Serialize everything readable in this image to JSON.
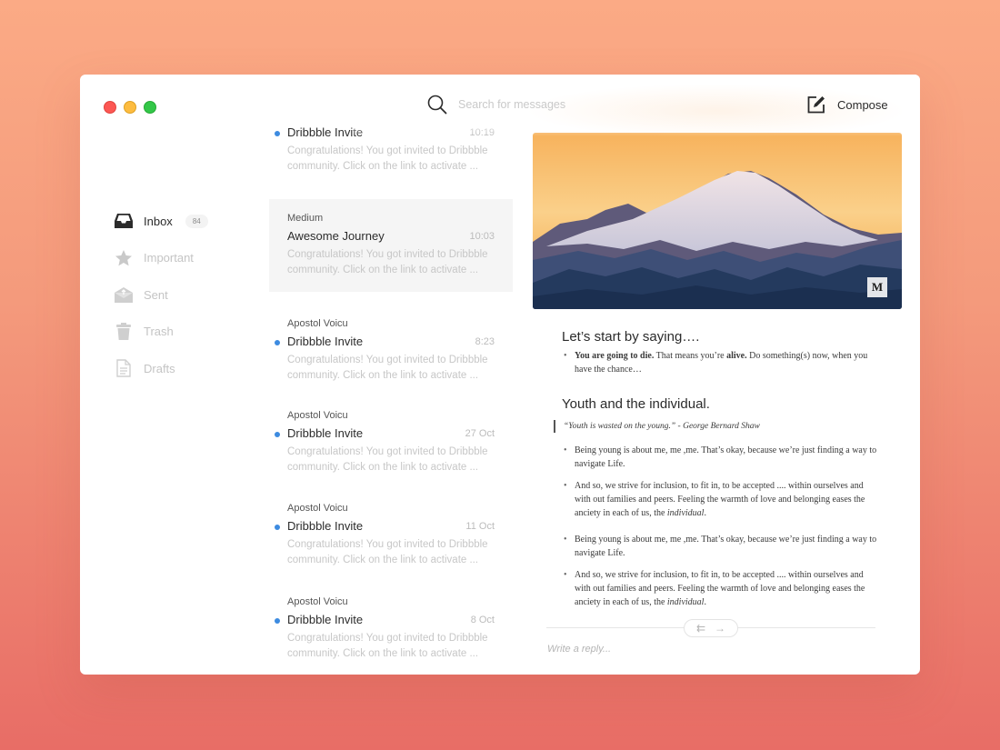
{
  "window": {
    "controls": [
      "close",
      "minimize",
      "maximize"
    ]
  },
  "header": {
    "search_placeholder": "Search for messages",
    "search_icon": "search-icon",
    "compose_label": "Compose",
    "compose_icon": "compose-icon"
  },
  "sidebar": {
    "items": [
      {
        "label": "Inbox",
        "icon": "inbox-icon",
        "badge": "84",
        "active": true
      },
      {
        "label": "Important",
        "icon": "star-icon"
      },
      {
        "label": "Sent",
        "icon": "sent-envelope-icon"
      },
      {
        "label": "Trash",
        "icon": "trash-icon"
      },
      {
        "label": "Drafts",
        "icon": "document-icon"
      }
    ]
  },
  "messages": [
    {
      "sender": "",
      "subject": "Dribbble Invite",
      "time": "10:19",
      "unread": true,
      "preview": "Congratulations! You got invited to Dribbble community. Click on the link to activate ..."
    },
    {
      "sender": "Medium",
      "subject": "Awesome Journey",
      "time": "10:03",
      "unread": false,
      "selected": true,
      "preview": "Congratulations! You got invited to Dribbble community. Click on the link to activate ..."
    },
    {
      "sender": "Apostol Voicu",
      "subject": "Dribbble Invite",
      "time": "8:23",
      "unread": true,
      "preview": "Congratulations! You got invited to Dribbble community. Click on the link to activate ..."
    },
    {
      "sender": "Apostol Voicu",
      "subject": "Dribbble Invite",
      "time": "27 Oct",
      "unread": true,
      "preview": "Congratulations! You got invited to Dribbble community. Click on the link to activate ..."
    },
    {
      "sender": "Apostol Voicu",
      "subject": "Dribbble Invite",
      "time": "11 Oct",
      "unread": true,
      "preview": "Congratulations! You got invited to Dribbble community. Click on the link to activate ..."
    },
    {
      "sender": "Apostol Voicu",
      "subject": "Dribbble Invite",
      "time": "8 Oct",
      "unread": true,
      "preview": "Congratulations! You got invited to Dribbble community. Click on the link to activate ..."
    }
  ],
  "reading": {
    "hero_badge": "M",
    "section1": {
      "title": "Let’s start by saying….",
      "bullet": {
        "bold1": "You are going to die.",
        "text1": " That means you’re ",
        "bold2": "alive.",
        "text2": " Do something(s) now, when you have the chance…"
      }
    },
    "section2": {
      "title": "Youth and the individual.",
      "quote": "“Youth is wasted on the young.” - George Bernard Shaw",
      "bullets": [
        {
          "text": "Being young is about me, me ,me. That’s okay, because we’re just finding a way to navigate Life."
        },
        {
          "text": "And so, we strive for inclusion, to fit in, to be accepted .... within ourselves and with out families and peers. Feeling the warmth of love and belonging eases the anciety in each of us, the ",
          "em": "individual",
          "end": "."
        },
        {
          "text": "Being young is about me, me ,me. That’s okay, because we’re just finding a way to navigate Life."
        },
        {
          "text": "And so, we strive for inclusion, to fit in, to be accepted .... within ourselves and with out families and peers. Feeling the warmth of love and belonging eases the anciety in each of us, the ",
          "em": "individual",
          "end": "."
        }
      ]
    },
    "nav": {
      "reply_all": "⇇",
      "forward": "→"
    },
    "reply_placeholder": "Write a reply..."
  },
  "colors": {
    "unread_dot": "#3d8be0",
    "bg_top": "#fbaa85",
    "bg_bottom": "#e86d66"
  }
}
